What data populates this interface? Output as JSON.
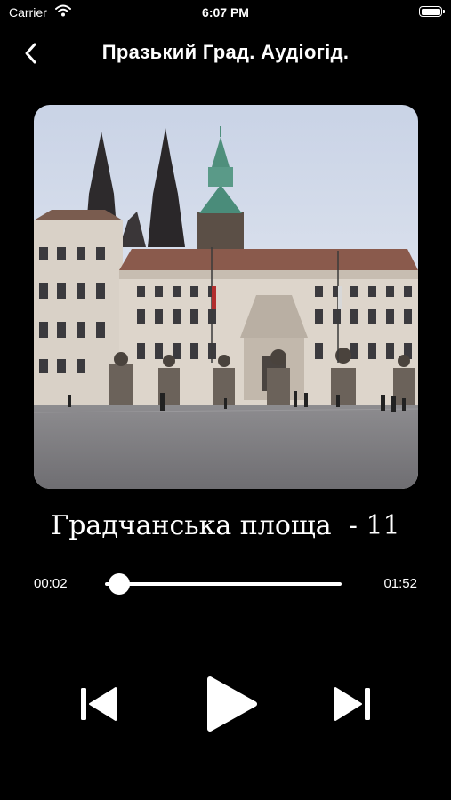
{
  "status": {
    "carrier": "Carrier",
    "time": "6:07 PM"
  },
  "header": {
    "title": "Празький Град. Аудіогід.",
    "back_icon": "chevron-left-icon"
  },
  "artwork": {
    "description_icon": "album-art-image"
  },
  "player": {
    "track_title": "Градчанська площа  - 11",
    "elapsed": "00:02",
    "duration": "01:52",
    "progress": 0.02
  },
  "controls": {
    "prev_icon": "skip-back-icon",
    "play_icon": "play-icon",
    "next_icon": "skip-forward-icon"
  },
  "colors": {
    "background": "#000000",
    "foreground": "#ffffff"
  }
}
